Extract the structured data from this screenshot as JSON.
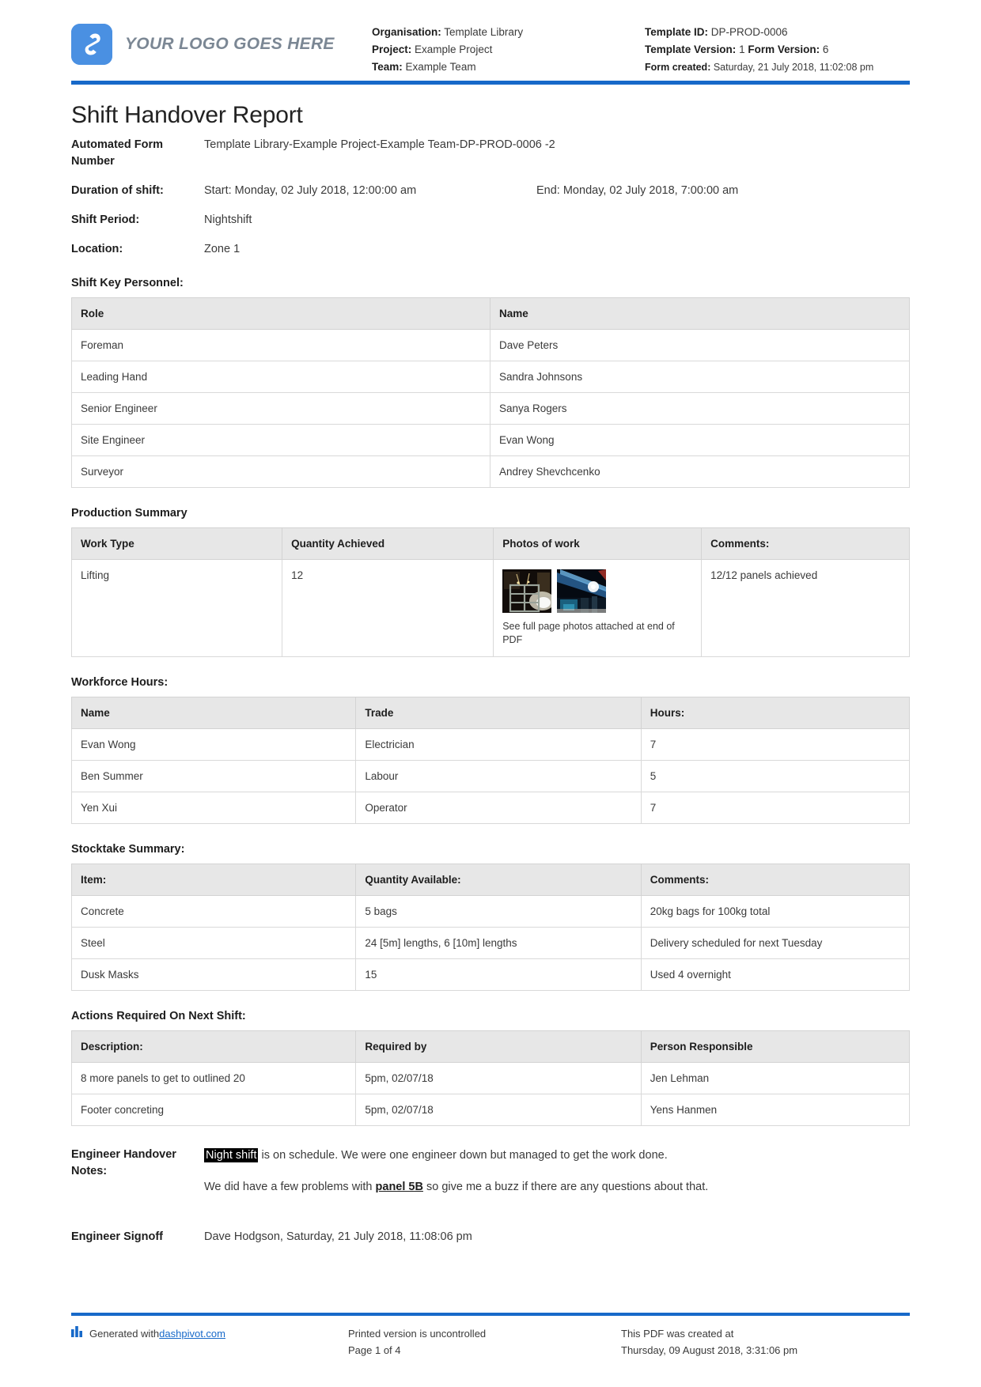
{
  "header": {
    "logo_text": "YOUR LOGO GOES HERE",
    "logo_icon": "dashpivot-logo-icon",
    "left_meta": [
      {
        "label": "Organisation:",
        "value": "Template Library"
      },
      {
        "label": "Project:",
        "value": "Example Project"
      },
      {
        "label": "Team:",
        "value": "Example Team"
      }
    ],
    "right_meta": {
      "template_id_label": "Template ID:",
      "template_id_value": "DP-PROD-0006",
      "template_version_label": "Template Version:",
      "template_version_value": "1",
      "form_version_label": "Form Version:",
      "form_version_value": "6",
      "form_created_label": "Form created:",
      "form_created_value": "Saturday, 21 July 2018, 11:02:08 pm"
    }
  },
  "title": "Shift Handover Report",
  "fields": {
    "automated_form_number_label": "Automated Form Number",
    "automated_form_number_value": "Template Library-Example Project-Example Team-DP-PROD-0006   -2",
    "duration_label": "Duration of shift:",
    "duration_start": "Start: Monday, 02 July 2018, 12:00:00 am",
    "duration_end": "End: Monday, 02 July 2018, 7:00:00 am",
    "shift_period_label": "Shift Period:",
    "shift_period_value": "Nightshift",
    "location_label": "Location:",
    "location_value": "Zone 1"
  },
  "personnel": {
    "heading": "Shift Key Personnel:",
    "columns": [
      "Role",
      "Name"
    ],
    "rows": [
      [
        "Foreman",
        "Dave Peters"
      ],
      [
        "Leading Hand",
        "Sandra Johnsons"
      ],
      [
        "Senior Engineer",
        "Sanya Rogers"
      ],
      [
        "Site Engineer",
        "Evan Wong"
      ],
      [
        "Surveyor",
        "Andrey Shevchcenko"
      ]
    ]
  },
  "production": {
    "heading": "Production Summary",
    "columns": [
      "Work Type",
      "Quantity Achieved",
      "Photos of work",
      "Comments:"
    ],
    "work_type": "Lifting",
    "quantity_achieved": "12",
    "photo_caption": "See full page photos attached at end of PDF",
    "photo_1_name": "night-construction-panel-photo",
    "photo_2_name": "night-crane-lighting-photo",
    "comments": "12/12 panels achieved"
  },
  "workforce": {
    "heading": "Workforce Hours:",
    "columns": [
      "Name",
      "Trade",
      "Hours:"
    ],
    "rows": [
      [
        "Evan Wong",
        "Electrician",
        "7"
      ],
      [
        "Ben Summer",
        "Labour",
        "5"
      ],
      [
        "Yen Xui",
        "Operator",
        "7"
      ]
    ]
  },
  "stocktake": {
    "heading": "Stocktake Summary:",
    "columns": [
      "Item:",
      "Quantity Available:",
      "Comments:"
    ],
    "rows": [
      [
        "Concrete",
        "5 bags",
        "20kg bags for 100kg total"
      ],
      [
        "Steel",
        "24 [5m] lengths, 6 [10m] lengths",
        "Delivery scheduled for next Tuesday"
      ],
      [
        "Dusk Masks",
        "15",
        "Used 4 overnight"
      ]
    ]
  },
  "actions": {
    "heading": "Actions Required On Next Shift:",
    "columns": [
      "Description:",
      "Required by",
      "Person Responsible"
    ],
    "rows": [
      [
        "8 more panels to get to outlined 20",
        "5pm, 02/07/18",
        "Jen Lehman"
      ],
      [
        "Footer concreting",
        "5pm, 02/07/18",
        "Yens Hanmen"
      ]
    ]
  },
  "notes": {
    "label": "Engineer Handover Notes:",
    "para1_highlight": "Night shift",
    "para1_rest": " is on schedule. We were one engineer down but managed to get the work done.",
    "para2_pre": "We did have a few problems with ",
    "para2_emphasis": "panel 5B",
    "para2_post": " so give me a buzz if there are any questions about that."
  },
  "signoff": {
    "label": "Engineer Signoff",
    "value": "Dave Hodgson, Saturday, 21 July 2018, 11:08:06 pm"
  },
  "footer": {
    "generated_prefix": "Generated with ",
    "generated_link": "dashpivot.com",
    "bar_icon": "bar-chart-icon",
    "uncontrolled_text": "Printed version is uncontrolled",
    "page_text": "Page 1 of 4",
    "created_text": "This PDF was created at",
    "created_date": "Thursday, 09 August 2018, 3:31:06 pm"
  },
  "colors": {
    "accent_blue": "#1769c9",
    "logo_blue": "#4a90e2",
    "table_header_gray": "#e7e7e7"
  }
}
